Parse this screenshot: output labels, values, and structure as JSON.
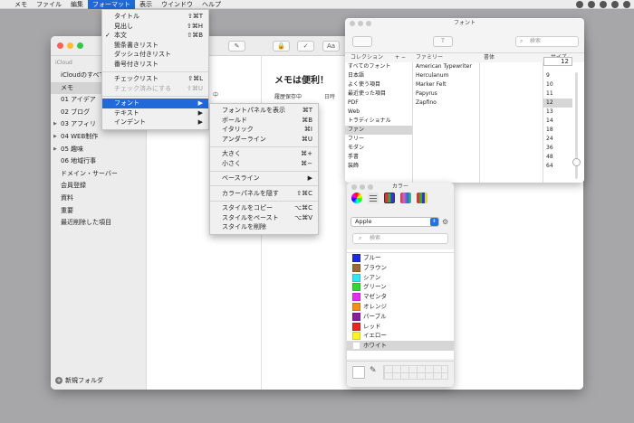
{
  "menubar": {
    "items": [
      "メモ",
      "ファイル",
      "編集",
      "フォーマット",
      "表示",
      "ウインドウ",
      "ヘルプ"
    ],
    "active_index": 3
  },
  "notes_window": {
    "sidebar_heading": "iCloud",
    "sidebar_items": [
      {
        "label": "iCloudのすべて",
        "tri": false
      },
      {
        "label": "メモ",
        "tri": false
      },
      {
        "label": "01 アイデア",
        "tri": false
      },
      {
        "label": "02 ブログ",
        "tri": false
      },
      {
        "label": "03 アフィリ",
        "tri": true
      },
      {
        "label": "04 WEB制作",
        "tri": true
      },
      {
        "label": "05 趣味",
        "tri": true
      },
      {
        "label": "06 地域行事",
        "tri": false
      },
      {
        "label": "ドメイン・サーバー",
        "tri": false
      },
      {
        "label": "会員登録",
        "tri": false
      },
      {
        "label": "資料",
        "tri": false
      },
      {
        "label": "重要",
        "tri": false
      },
      {
        "label": "最近削除した項目",
        "tri": false
      }
    ],
    "selected_index": 1,
    "new_folder_label": "新規フォルダ",
    "list_snippet": "中",
    "note_title": "メモは便利！",
    "note_body": "履歴保存中",
    "note_extra": "日時"
  },
  "format_menu": {
    "items": [
      {
        "label": "タイトル",
        "shortcut": "⇧⌘T"
      },
      {
        "label": "見出し",
        "shortcut": "⇧⌘H"
      },
      {
        "label": "本文",
        "shortcut": "⇧⌘B",
        "checked": true
      },
      {
        "label": "箇条書きリスト",
        "shortcut": ""
      },
      {
        "label": "ダッシュ付きリスト",
        "shortcut": ""
      },
      {
        "label": "番号付きリスト",
        "shortcut": ""
      },
      {
        "sep": true
      },
      {
        "label": "チェックリスト",
        "shortcut": "⇧⌘L"
      },
      {
        "label": "チェック済みにする",
        "shortcut": "⇧⌘U",
        "disabled": true
      },
      {
        "sep": true
      },
      {
        "label": "フォント",
        "submenu": true,
        "highlight": true
      },
      {
        "label": "テキスト",
        "submenu": true
      },
      {
        "label": "インデント",
        "submenu": true
      }
    ]
  },
  "font_submenu": {
    "items": [
      {
        "label": "フォントパネルを表示",
        "shortcut": "⌘T"
      },
      {
        "label": "ボールド",
        "shortcut": "⌘B"
      },
      {
        "label": "イタリック",
        "shortcut": "⌘I"
      },
      {
        "label": "アンダーライン",
        "shortcut": "⌘U"
      },
      {
        "sep": true
      },
      {
        "label": "大きく",
        "shortcut": "⌘+"
      },
      {
        "label": "小さく",
        "shortcut": "⌘−"
      },
      {
        "sep": true
      },
      {
        "label": "ベースライン",
        "submenu": true
      },
      {
        "sep": true
      },
      {
        "label": "カラーパネルを隠す",
        "shortcut": "⇧⌘C"
      },
      {
        "sep": true
      },
      {
        "label": "スタイルをコピー",
        "shortcut": "⌥⌘C"
      },
      {
        "label": "スタイルをペースト",
        "shortcut": "⌥⌘V"
      },
      {
        "label": "スタイルを削除",
        "shortcut": ""
      }
    ]
  },
  "font_panel": {
    "title": "フォント",
    "search_placeholder": "検索",
    "col_collection": "コレクション",
    "col_family": "ファミリー",
    "col_typeface": "書体",
    "col_size": "サイズ",
    "size_value": "12",
    "collections": [
      "すべてのフォント",
      "日本語",
      "よく使う項目",
      "最近使った項目",
      "PDF",
      "Web",
      "トラディショナル",
      "ファン",
      "フリー",
      "モダン",
      "手書",
      "装飾"
    ],
    "collection_selected": 7,
    "families": [
      "American Typewriter",
      "Herculanum",
      "Marker Felt",
      "Papyrus",
      "Zapfino"
    ],
    "sizes": [
      "9",
      "10",
      "11",
      "12",
      "13",
      "14",
      "18",
      "24",
      "36",
      "48",
      "64"
    ],
    "size_selected": 3
  },
  "color_panel": {
    "title": "カラー",
    "palette": "Apple",
    "search_placeholder": "検索",
    "colors": [
      {
        "name": "ブルー",
        "hex": "#1f2bd8"
      },
      {
        "name": "ブラウン",
        "hex": "#9a6a34"
      },
      {
        "name": "シアン",
        "hex": "#30e8f0"
      },
      {
        "name": "グリーン",
        "hex": "#35d632"
      },
      {
        "name": "マゼンタ",
        "hex": "#e32fe8"
      },
      {
        "name": "オレンジ",
        "hex": "#f48d13"
      },
      {
        "name": "パープル",
        "hex": "#8b1a9c"
      },
      {
        "name": "レッド",
        "hex": "#e8251f"
      },
      {
        "name": "イエロー",
        "hex": "#fbf226"
      },
      {
        "name": "ホワイト",
        "hex": "#ffffff"
      }
    ],
    "selected_index": 9
  },
  "colors": {
    "accent": "#1f69d8",
    "close": "#fc5f57",
    "minimize": "#fdbc2e",
    "zoom": "#33c748"
  }
}
